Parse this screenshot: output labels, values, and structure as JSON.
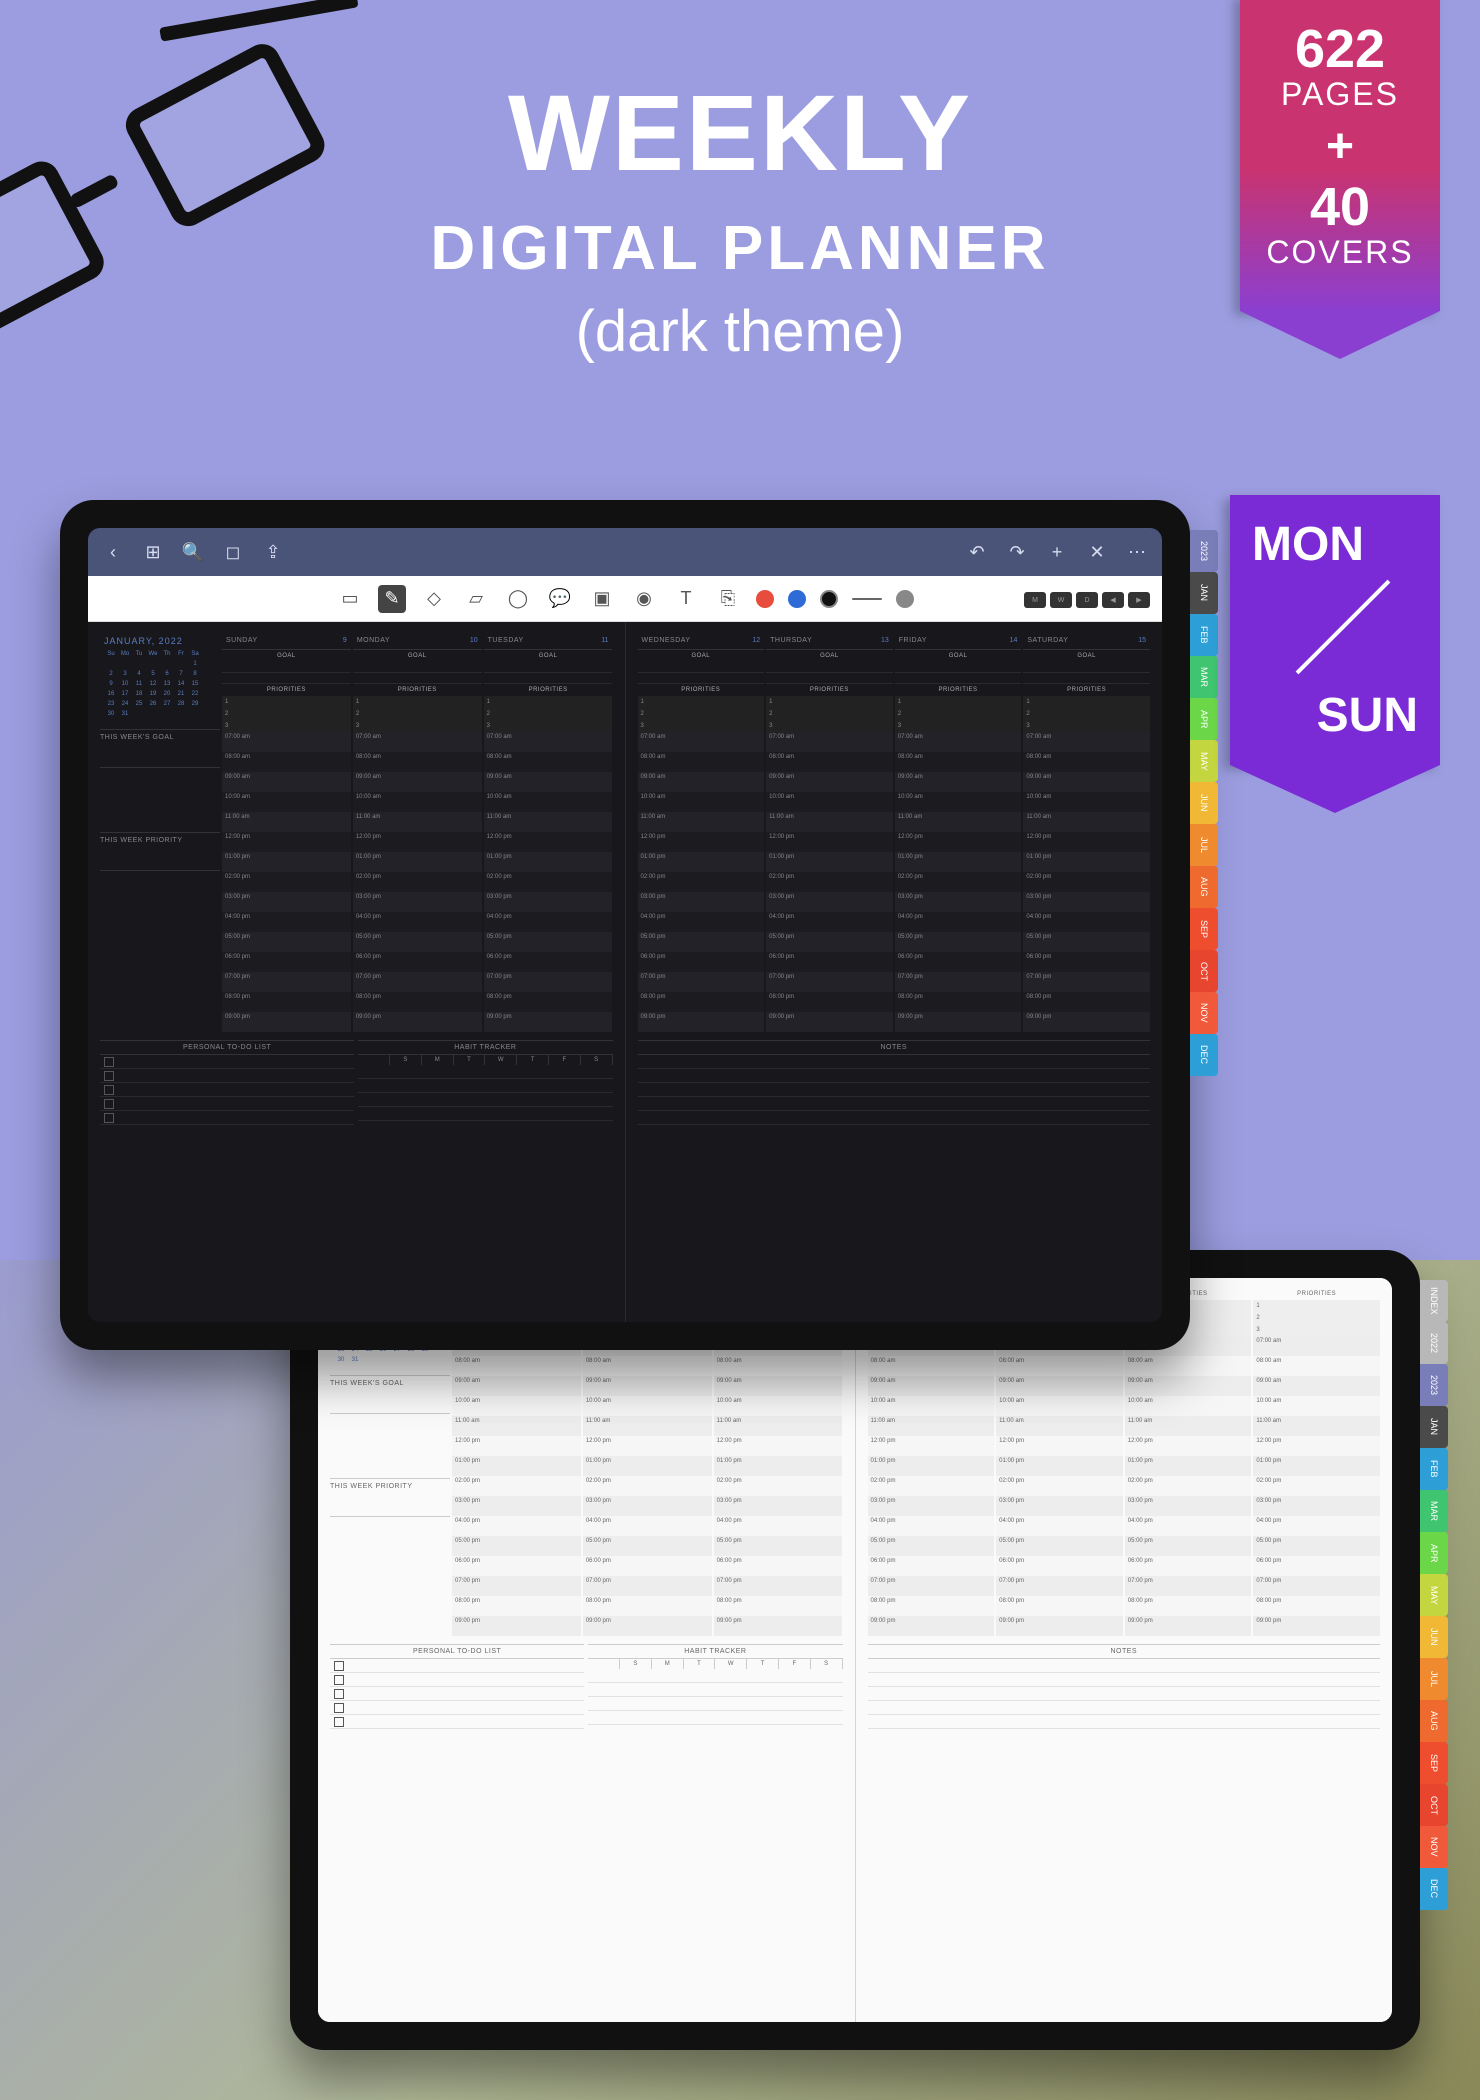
{
  "header": {
    "title": "WEEKLY",
    "subtitle": "DIGITAL PLANNER",
    "theme": "(dark theme)"
  },
  "ribbon": {
    "pages_count": "622",
    "pages_label": "PAGES",
    "plus": "+",
    "covers_count": "40",
    "covers_label": "COVERS"
  },
  "monsun": {
    "mon": "MON",
    "sun": "SUN"
  },
  "appbar_icons": [
    "back",
    "grid",
    "search",
    "bookmark",
    "share",
    "undo",
    "redo",
    "add",
    "close",
    "more"
  ],
  "toolbar": {
    "tools": [
      "select",
      "pen",
      "eraser",
      "highlighter",
      "lasso",
      "comment",
      "image",
      "camera",
      "text",
      "link"
    ],
    "colors": [
      "#e74c3c",
      "#2e6bd6",
      "#111"
    ],
    "fill": "#888"
  },
  "planner": {
    "month_title": "JANUARY, 2022",
    "nav": [
      "M",
      "W",
      "D",
      "◀",
      "▶"
    ],
    "week_days_short": [
      "Su",
      "Mo",
      "Tu",
      "We",
      "Th",
      "Fr",
      "Sa"
    ],
    "mini_cal": [
      [
        "",
        "",
        "",
        "",
        "",
        "",
        "1"
      ],
      [
        "2",
        "3",
        "4",
        "5",
        "6",
        "7",
        "8"
      ],
      [
        "9",
        "10",
        "11",
        "12",
        "13",
        "14",
        "15"
      ],
      [
        "16",
        "17",
        "18",
        "19",
        "20",
        "21",
        "22"
      ],
      [
        "23",
        "24",
        "25",
        "26",
        "27",
        "28",
        "29"
      ],
      [
        "30",
        "31",
        "",
        "",
        "",
        "",
        ""
      ]
    ],
    "side": {
      "goal": "THIS WEEK'S GOAL",
      "priority": "THIS WEEK PRIORITY"
    },
    "labels": {
      "goal": "GOAL",
      "priorities": "PRIORITIES",
      "todo": "PERSONAL TO-DO LIST",
      "habit": "HABIT TRACKER",
      "notes": "NOTES"
    },
    "days_left": [
      {
        "name": "SUNDAY",
        "num": "9"
      },
      {
        "name": "MONDAY",
        "num": "10"
      },
      {
        "name": "TUESDAY",
        "num": "11"
      }
    ],
    "days_right": [
      {
        "name": "WEDNESDAY",
        "num": "12"
      },
      {
        "name": "THURSDAY",
        "num": "13"
      },
      {
        "name": "FRIDAY",
        "num": "14"
      },
      {
        "name": "SATURDAY",
        "num": "15"
      }
    ],
    "priority_nums": [
      "1",
      "2",
      "3"
    ],
    "hours": [
      "07:00 am",
      "08:00 am",
      "09:00 am",
      "10:00 am",
      "11:00 am",
      "12:00 pm",
      "01:00 pm",
      "02:00 pm",
      "03:00 pm",
      "04:00 pm",
      "05:00 pm",
      "06:00 pm",
      "07:00 pm",
      "08:00 pm",
      "09:00 pm"
    ],
    "habit_days": [
      "S",
      "M",
      "T",
      "W",
      "T",
      "F",
      "S"
    ]
  },
  "tabs": [
    {
      "label": "2023",
      "color": "#7a7eb8"
    },
    {
      "label": "JAN",
      "color": "#4a4a4a"
    },
    {
      "label": "FEB",
      "color": "#2e9fd6"
    },
    {
      "label": "MAR",
      "color": "#3fc46f"
    },
    {
      "label": "APR",
      "color": "#6bd648"
    },
    {
      "label": "MAY",
      "color": "#c4d63f"
    },
    {
      "label": "JUN",
      "color": "#f0b834"
    },
    {
      "label": "JUL",
      "color": "#f08a2e"
    },
    {
      "label": "AUG",
      "color": "#ee6a2e"
    },
    {
      "label": "SEP",
      "color": "#ee4e2e"
    },
    {
      "label": "OCT",
      "color": "#e8452e"
    },
    {
      "label": "NOV",
      "color": "#f05a3a"
    },
    {
      "label": "DEC",
      "color": "#2e9fd6"
    }
  ],
  "tabs_light_extra": [
    {
      "label": "INDEX",
      "color": "#b8b8b8"
    },
    {
      "label": "2022",
      "color": "#b8b8b8"
    }
  ]
}
